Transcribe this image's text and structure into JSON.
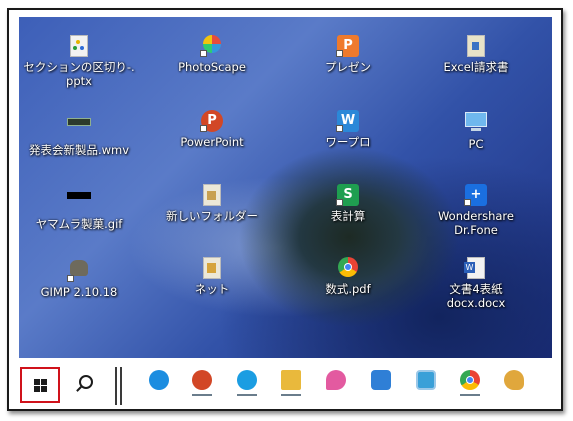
{
  "desktop": {
    "icons": [
      {
        "label": "セクションの区切り-.\npptx",
        "icon": "pptx-file-icon"
      },
      {
        "label": "PhotoScape",
        "icon": "photoscape-icon"
      },
      {
        "label": "プレゼン",
        "icon": "presentation-app-icon"
      },
      {
        "label": "Excel請求書",
        "icon": "excel-file-icon"
      },
      {
        "label": "発表会新製品.wmv",
        "icon": "video-file-icon"
      },
      {
        "label": "PowerPoint",
        "icon": "powerpoint-icon"
      },
      {
        "label": "ワープロ",
        "icon": "word-processor-icon"
      },
      {
        "label": "PC",
        "icon": "computer-icon"
      },
      {
        "label": "ヤマムラ製菓.gif",
        "icon": "gif-file-icon"
      },
      {
        "label": "新しいフォルダー",
        "icon": "folder-icon"
      },
      {
        "label": "表計算",
        "icon": "spreadsheet-app-icon"
      },
      {
        "label": "Wondershare\nDr.Fone",
        "icon": "drfone-icon"
      },
      {
        "label": "GIMP 2.10.18",
        "icon": "gimp-icon"
      },
      {
        "label": "ネット",
        "icon": "folder-net-icon"
      },
      {
        "label": "数式.pdf",
        "icon": "chrome-pdf-icon"
      },
      {
        "label": "文書4表紙\ndocx.docx",
        "icon": "word-file-icon"
      }
    ]
  },
  "taskbar": {
    "start_icon": "windows-start-icon",
    "search_icon": "search-icon",
    "pinned": [
      {
        "icon": "internet-explorer-icon",
        "color": "#1c8de0"
      },
      {
        "icon": "powerpoint-icon",
        "color": "#d24726"
      },
      {
        "icon": "edge-icon",
        "color": "#1b9de2"
      },
      {
        "icon": "file-explorer-icon",
        "color": "#e9b93c"
      },
      {
        "icon": "paint3d-icon",
        "color": "#e35aa0"
      },
      {
        "icon": "photos-icon",
        "color": "#2f7fd6"
      },
      {
        "icon": "image-viewer-icon",
        "color": "#3aa0d8"
      },
      {
        "icon": "chrome-icon",
        "color": "#34a853"
      },
      {
        "icon": "paint-icon",
        "color": "#e0a73c"
      }
    ]
  },
  "colors": {
    "start_highlight": "#d0121b",
    "taskbar_bg": "#ffffff"
  }
}
